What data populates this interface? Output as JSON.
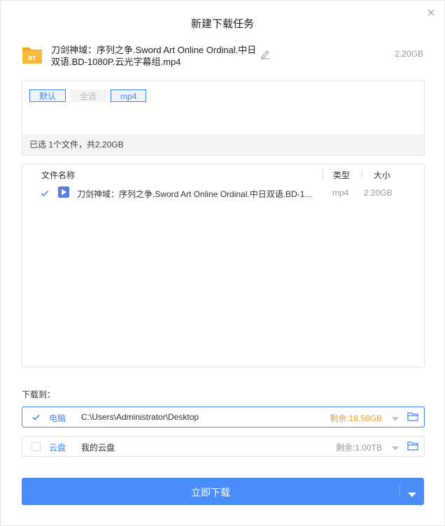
{
  "dialog": {
    "title": "新建下载任务"
  },
  "file": {
    "name": "刀剑神域：序列之争.Sword Art Online Ordinal.中日双语.BD-1080P.云光字幕组.mp4",
    "size": "2.20GB",
    "icon_text": "BT"
  },
  "filter": {
    "tags": [
      "默认",
      "全选",
      "mp4"
    ],
    "selected_text": "已选 1个文件，共2.20GB"
  },
  "list": {
    "headers": {
      "name": "文件名称",
      "type": "类型",
      "size": "大小"
    },
    "rows": [
      {
        "checked": true,
        "name": "刀剑神域：序列之争.Sword Art Online Ordinal.中日双语.BD-1...",
        "type": "mp4",
        "size": "2.20GB"
      }
    ]
  },
  "destination": {
    "label": "下载到：",
    "pc": {
      "checked": true,
      "name": "电脑",
      "path": "C:\\Users\\Administrator\\Desktop",
      "free": "剩余:18.58GB"
    },
    "cloud": {
      "checked": false,
      "name": "云盘",
      "path": "我的云盘",
      "free": "剩余:1.00TB"
    }
  },
  "actions": {
    "download_now": "立即下载"
  },
  "colors": {
    "accent": "#4b8df8",
    "folder": "#f5a623",
    "warning": "#f09a2c"
  }
}
